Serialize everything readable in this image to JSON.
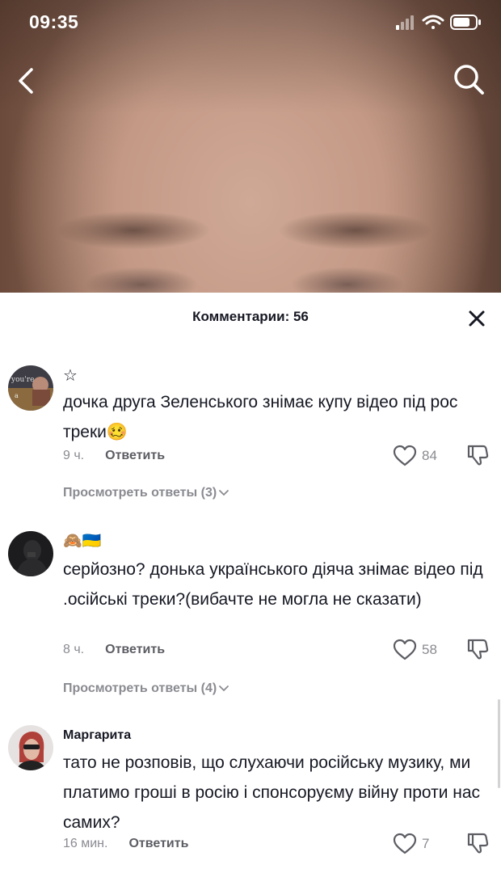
{
  "status_bar": {
    "time": "09:35"
  },
  "comments_panel": {
    "title": "Комментарии: 56"
  },
  "comments": [
    {
      "username": "☆",
      "text": "дочка друга Зеленського знімає купу відео під рос треки🥴",
      "time": "9 ч.",
      "reply_label": "Ответить",
      "likes": "84",
      "view_replies": "Просмотреть ответы (3)"
    },
    {
      "username": "🙈🇺🇦",
      "text": "серйозно? донька українського діяча знімає відео під .осійські треки?(вибачте не могла не сказати)",
      "time": "8 ч.",
      "reply_label": "Ответить",
      "likes": "58",
      "view_replies": "Просмотреть ответы (4)"
    },
    {
      "username": "Маргарита",
      "text": "тато не розповів, що слухаючи російську музику, ми платимо гроші в росію і спонсоруєму війну проти нас самих?",
      "time": "16 мин.",
      "reply_label": "Ответить",
      "likes": "7"
    }
  ],
  "colors": {
    "text_primary": "#161823",
    "text_secondary": "#8a8b91"
  }
}
